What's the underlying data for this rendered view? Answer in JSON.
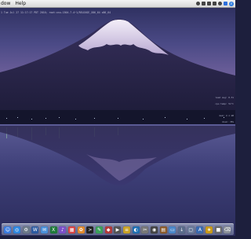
{
  "menubar": {
    "items": [
      "dow",
      "Help"
    ]
  },
  "tray": {
    "icons": [
      "bluetooth-icon",
      "wifi-icon",
      "volume-icon",
      "battery-icon",
      "clock-icon",
      "user-icon"
    ],
    "spotlight": "search-icon"
  },
  "terminal": {
    "line": "1 Tue Jul 27 11:17:17 PDT 2010; root:xnu-1504.7.4~1/RELEASE_X86_64 x86_64"
  },
  "side_notes": [
    "load avg: 0.31",
    "cpu temp: 51°C",
    "mem: 2.1 GB",
    "disk: 78%"
  ],
  "dock": {
    "icons": [
      {
        "name": "finder-icon",
        "glyph": "☺",
        "color": "#3b7ce0"
      },
      {
        "name": "browser-icon",
        "glyph": "◎",
        "color": "#2e86de"
      },
      {
        "name": "settings-icon",
        "glyph": "⚙",
        "color": "#6c7a89"
      },
      {
        "name": "word-icon",
        "glyph": "W",
        "color": "#2c5aa0"
      },
      {
        "name": "mail-icon",
        "glyph": "✉",
        "color": "#4a90d9"
      },
      {
        "name": "excel-icon",
        "glyph": "X",
        "color": "#1f7a3a"
      },
      {
        "name": "music-icon",
        "glyph": "♪",
        "color": "#7a4fc9"
      },
      {
        "name": "calendar-icon",
        "glyph": "▦",
        "color": "#d64545"
      },
      {
        "name": "photos-icon",
        "glyph": "✿",
        "color": "#e08a2e"
      },
      {
        "name": "terminal-icon",
        "glyph": ">",
        "color": "#222222"
      },
      {
        "name": "chat-icon",
        "glyph": "✎",
        "color": "#3aa05a"
      },
      {
        "name": "app-icon",
        "glyph": "◆",
        "color": "#b23a3a"
      },
      {
        "name": "video-icon",
        "glyph": "▶",
        "color": "#555555"
      },
      {
        "name": "notes-icon",
        "glyph": "≡",
        "color": "#c9a227"
      },
      {
        "name": "globe-icon",
        "glyph": "◐",
        "color": "#1f6fb2"
      },
      {
        "name": "tool-icon",
        "glyph": "✂",
        "color": "#777777"
      },
      {
        "name": "camera-icon",
        "glyph": "◉",
        "color": "#444444"
      },
      {
        "name": "book-icon",
        "glyph": "▤",
        "color": "#8a5a2b"
      },
      {
        "name": "folder-icon",
        "glyph": "▭",
        "color": "#4a86c8"
      },
      {
        "name": "downloads-icon",
        "glyph": "↓",
        "color": "#5a6b8a"
      },
      {
        "name": "documents-icon",
        "glyph": "▢",
        "color": "#6a7a9a"
      },
      {
        "name": "apps-folder-icon",
        "glyph": "A",
        "color": "#3a6ab0"
      },
      {
        "name": "star-icon",
        "glyph": "★",
        "color": "#c99a1a"
      },
      {
        "name": "archive-icon",
        "glyph": "■",
        "color": "#6b6b6b"
      },
      {
        "name": "trash-icon",
        "glyph": "⌫",
        "color": "#8a9099"
      }
    ]
  }
}
